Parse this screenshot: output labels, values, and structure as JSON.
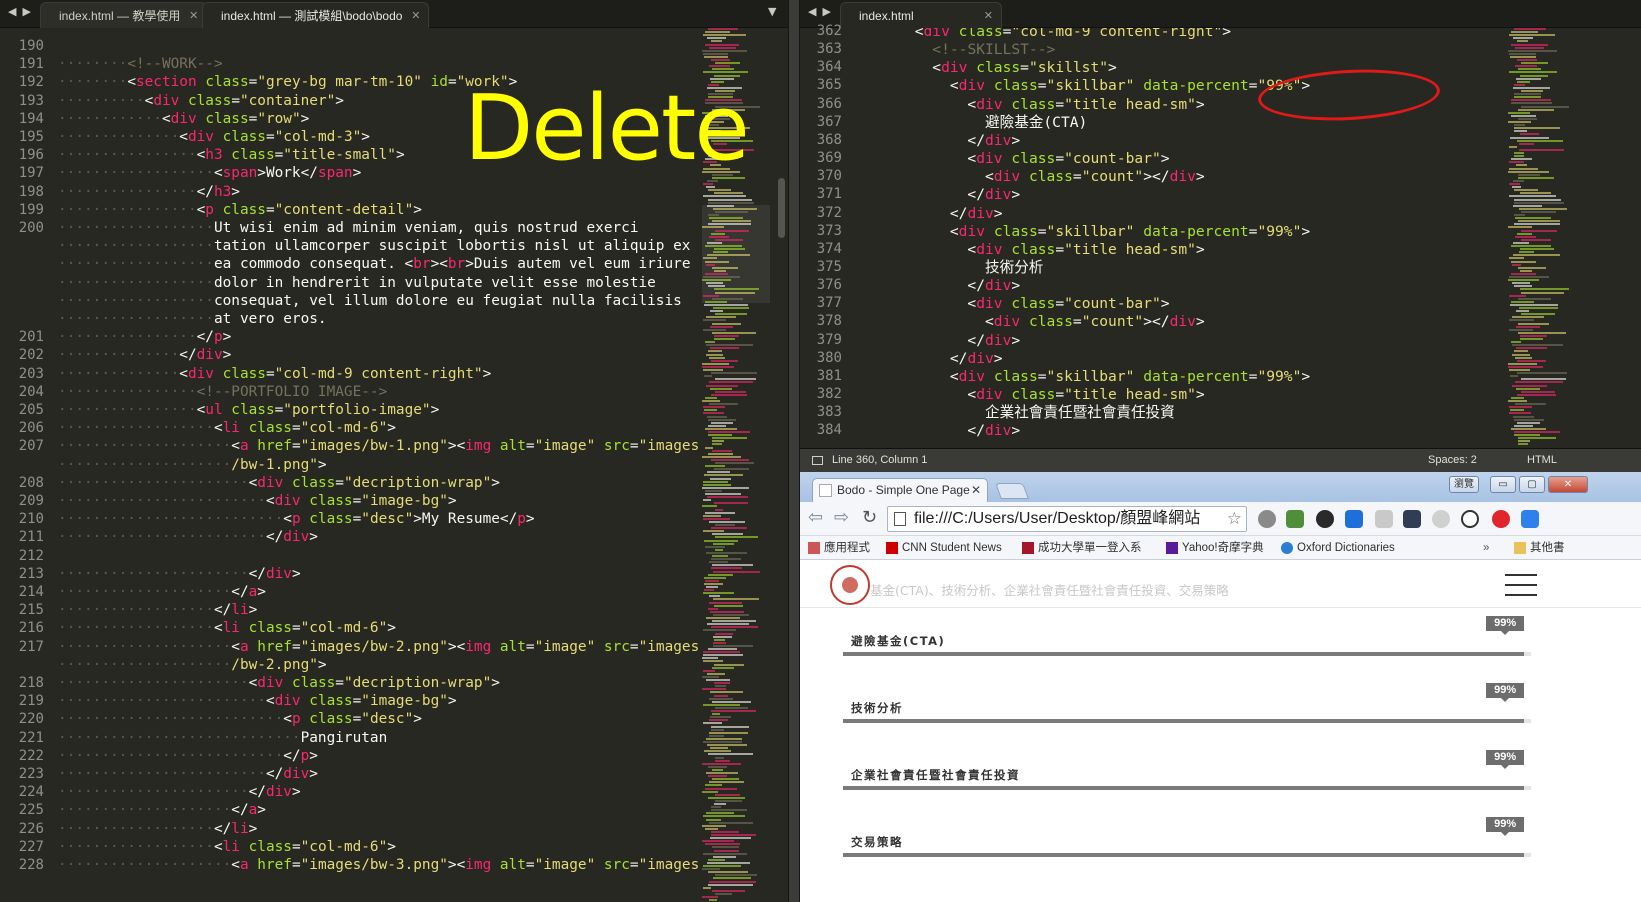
{
  "left_editor": {
    "tabs": [
      {
        "label": "index.html — 教學使用",
        "active": false
      },
      {
        "label": "index.html — 測試模組\\bodo\\bodo",
        "active": true
      }
    ],
    "annotation": "Delete",
    "lines": [
      {
        "n": "190",
        "indent": 0,
        "html": ""
      },
      {
        "n": "191",
        "indent": 4,
        "html": "<span class=\"c\">&lt;!--WORK--&gt;</span>"
      },
      {
        "n": "192",
        "indent": 4,
        "html": "&lt;<span class=\"t\">section</span> <span class=\"a\">class</span>=<span class=\"s\">\"grey-bg mar-tm-10\"</span> <span class=\"a\">id</span>=<span class=\"s\">\"work\"</span>&gt;"
      },
      {
        "n": "193",
        "indent": 5,
        "html": "&lt;<span class=\"t\">div</span> <span class=\"a\">class</span>=<span class=\"s\">\"container\"</span>&gt;"
      },
      {
        "n": "194",
        "indent": 6,
        "html": "&lt;<span class=\"t\">div</span> <span class=\"a\">class</span>=<span class=\"s\">\"row\"</span>&gt;"
      },
      {
        "n": "195",
        "indent": 7,
        "html": "&lt;<span class=\"t\">div</span> <span class=\"a\">class</span>=<span class=\"s\">\"col-md-3\"</span>&gt;"
      },
      {
        "n": "196",
        "indent": 8,
        "html": "&lt;<span class=\"t\">h3</span> <span class=\"a\">class</span>=<span class=\"s\">\"title-small\"</span>&gt;"
      },
      {
        "n": "197",
        "indent": 9,
        "html": "&lt;<span class=\"t\">span</span>&gt;Work&lt;/<span class=\"t\">span</span>&gt;"
      },
      {
        "n": "198",
        "indent": 8,
        "html": "&lt;/<span class=\"t\">h3</span>&gt;"
      },
      {
        "n": "199",
        "indent": 8,
        "html": "&lt;<span class=\"t\">p</span> <span class=\"a\">class</span>=<span class=\"s\">\"content-detail\"</span>&gt;"
      },
      {
        "n": "200",
        "indent": 9,
        "html": "Ut wisi enim ad minim veniam, quis nostrud exerci"
      },
      {
        "n": "",
        "indent": 9,
        "html": "tation ullamcorper suscipit lobortis nisl ut aliquip ex"
      },
      {
        "n": "",
        "indent": 9,
        "html": "ea commodo consequat. &lt;<span class=\"t\">br</span>&gt;&lt;<span class=\"t\">br</span>&gt;Duis autem vel eum iriure"
      },
      {
        "n": "",
        "indent": 9,
        "html": "dolor in hendrerit in vulputate velit esse molestie"
      },
      {
        "n": "",
        "indent": 9,
        "html": "consequat, vel illum dolore eu feugiat nulla facilisis"
      },
      {
        "n": "",
        "indent": 9,
        "html": "at vero eros."
      },
      {
        "n": "201",
        "indent": 8,
        "html": "&lt;/<span class=\"t\">p</span>&gt;"
      },
      {
        "n": "202",
        "indent": 7,
        "html": "&lt;/<span class=\"t\">div</span>&gt;"
      },
      {
        "n": "203",
        "indent": 7,
        "html": "&lt;<span class=\"t\">div</span> <span class=\"a\">class</span>=<span class=\"s\">\"col-md-9 content-right\"</span>&gt;"
      },
      {
        "n": "204",
        "indent": 8,
        "html": "<span class=\"c\">&lt;!--PORTFOLIO IMAGE--&gt;</span>"
      },
      {
        "n": "205",
        "indent": 8,
        "html": "&lt;<span class=\"t\">ul</span> <span class=\"a\">class</span>=<span class=\"s\">\"portfolio-image\"</span>&gt;"
      },
      {
        "n": "206",
        "indent": 9,
        "html": "&lt;<span class=\"t\">li</span> <span class=\"a\">class</span>=<span class=\"s\">\"col-md-6\"</span>&gt;"
      },
      {
        "n": "207",
        "indent": 10,
        "html": "&lt;<span class=\"t\">a</span> <span class=\"a\">href</span>=<span class=\"s\">\"images/bw-1.png\"</span>&gt;&lt;<span class=\"t\">img</span> <span class=\"a\">alt</span>=<span class=\"s\">\"image\"</span> <span class=\"a\">src</span>=<span class=\"s\">\"images</span>"
      },
      {
        "n": "",
        "indent": 10,
        "html": "<span class=\"s\">/bw-1.png\"</span>&gt;"
      },
      {
        "n": "208",
        "indent": 11,
        "html": "&lt;<span class=\"t\">div</span> <span class=\"a\">class</span>=<span class=\"s\">\"decription-wrap\"</span>&gt;"
      },
      {
        "n": "209",
        "indent": 12,
        "html": "&lt;<span class=\"t\">div</span> <span class=\"a\">class</span>=<span class=\"s\">\"image-bg\"</span>&gt;"
      },
      {
        "n": "210",
        "indent": 13,
        "html": "&lt;<span class=\"t\">p</span> <span class=\"a\">class</span>=<span class=\"s\">\"desc\"</span>&gt;My Resume&lt;/<span class=\"t\">p</span>&gt;"
      },
      {
        "n": "211",
        "indent": 12,
        "html": "&lt;/<span class=\"t\">div</span>&gt;"
      },
      {
        "n": "212",
        "indent": 0,
        "html": ""
      },
      {
        "n": "213",
        "indent": 11,
        "html": "&lt;/<span class=\"t\">div</span>&gt;"
      },
      {
        "n": "214",
        "indent": 10,
        "html": "&lt;/<span class=\"t\">a</span>&gt;"
      },
      {
        "n": "215",
        "indent": 9,
        "html": "&lt;/<span class=\"t\">li</span>&gt;"
      },
      {
        "n": "216",
        "indent": 9,
        "html": "&lt;<span class=\"t\">li</span> <span class=\"a\">class</span>=<span class=\"s\">\"col-md-6\"</span>&gt;"
      },
      {
        "n": "217",
        "indent": 10,
        "html": "&lt;<span class=\"t\">a</span> <span class=\"a\">href</span>=<span class=\"s\">\"images/bw-2.png\"</span>&gt;&lt;<span class=\"t\">img</span> <span class=\"a\">alt</span>=<span class=\"s\">\"image\"</span> <span class=\"a\">src</span>=<span class=\"s\">\"images</span>"
      },
      {
        "n": "",
        "indent": 10,
        "html": "<span class=\"s\">/bw-2.png\"</span>&gt;"
      },
      {
        "n": "218",
        "indent": 11,
        "html": "&lt;<span class=\"t\">div</span> <span class=\"a\">class</span>=<span class=\"s\">\"decription-wrap\"</span>&gt;"
      },
      {
        "n": "219",
        "indent": 12,
        "html": "&lt;<span class=\"t\">div</span> <span class=\"a\">class</span>=<span class=\"s\">\"image-bg\"</span>&gt;"
      },
      {
        "n": "220",
        "indent": 13,
        "html": "&lt;<span class=\"t\">p</span> <span class=\"a\">class</span>=<span class=\"s\">\"desc\"</span>&gt;"
      },
      {
        "n": "221",
        "indent": 14,
        "html": "Pangirutan"
      },
      {
        "n": "222",
        "indent": 13,
        "html": "&lt;/<span class=\"t\">p</span>&gt;"
      },
      {
        "n": "223",
        "indent": 12,
        "html": "&lt;/<span class=\"t\">div</span>&gt;"
      },
      {
        "n": "224",
        "indent": 11,
        "html": "&lt;/<span class=\"t\">div</span>&gt;"
      },
      {
        "n": "225",
        "indent": 10,
        "html": "&lt;/<span class=\"t\">a</span>&gt;"
      },
      {
        "n": "226",
        "indent": 9,
        "html": "&lt;/<span class=\"t\">li</span>&gt;"
      },
      {
        "n": "227",
        "indent": 9,
        "html": "&lt;<span class=\"t\">li</span> <span class=\"a\">class</span>=<span class=\"s\">\"col-md-6\"</span>&gt;"
      },
      {
        "n": "228",
        "indent": 10,
        "html": "&lt;<span class=\"t\">a</span> <span class=\"a\">href</span>=<span class=\"s\">\"images/bw-3.png\"</span>&gt;&lt;<span class=\"t\">img</span> <span class=\"a\">alt</span>=<span class=\"s\">\"image\"</span> <span class=\"a\">src</span>=<span class=\"s\">\"images</span>"
      }
    ]
  },
  "right_editor": {
    "tab": "index.html",
    "lines": [
      {
        "n": "362",
        "html": "      &lt;<span class=\"t\">div</span> <span class=\"a\">class</span>=<span class=\"s\">\"col-md-9 content-right\"</span>&gt;"
      },
      {
        "n": "363",
        "html": "        <span class=\"c\">&lt;!--SKILLST--&gt;</span>"
      },
      {
        "n": "364",
        "html": "        &lt;<span class=\"t\">div</span> <span class=\"a\">class</span>=<span class=\"s\">\"skillst\"</span>&gt;"
      },
      {
        "n": "365",
        "html": "          &lt;<span class=\"t\">div</span> <span class=\"a\">class</span>=<span class=\"s\">\"skillbar\"</span> <span class=\"a\">data-percent</span>=<span class=\"s\">\"99%\"</span>&gt;"
      },
      {
        "n": "366",
        "html": "            &lt;<span class=\"t\">div</span> <span class=\"a\">class</span>=<span class=\"s\">\"title head-sm\"</span>&gt;"
      },
      {
        "n": "367",
        "html": "              避險基金(CTA)"
      },
      {
        "n": "368",
        "html": "            &lt;/<span class=\"t\">div</span>&gt;"
      },
      {
        "n": "369",
        "html": "            &lt;<span class=\"t\">div</span> <span class=\"a\">class</span>=<span class=\"s\">\"count-bar\"</span>&gt;"
      },
      {
        "n": "370",
        "html": "              &lt;<span class=\"t\">div</span> <span class=\"a\">class</span>=<span class=\"s\">\"count\"</span>&gt;&lt;/<span class=\"t\">div</span>&gt;"
      },
      {
        "n": "371",
        "html": "            &lt;/<span class=\"t\">div</span>&gt;"
      },
      {
        "n": "372",
        "html": "          &lt;/<span class=\"t\">div</span>&gt;"
      },
      {
        "n": "373",
        "html": "          &lt;<span class=\"t\">div</span> <span class=\"a\">class</span>=<span class=\"s\">\"skillbar\"</span> <span class=\"a\">data-percent</span>=<span class=\"s\">\"99%\"</span>&gt;"
      },
      {
        "n": "374",
        "html": "            &lt;<span class=\"t\">div</span> <span class=\"a\">class</span>=<span class=\"s\">\"title head-sm\"</span>&gt;"
      },
      {
        "n": "375",
        "html": "              技術分析"
      },
      {
        "n": "376",
        "html": "            &lt;/<span class=\"t\">div</span>&gt;"
      },
      {
        "n": "377",
        "html": "            &lt;<span class=\"t\">div</span> <span class=\"a\">class</span>=<span class=\"s\">\"count-bar\"</span>&gt;"
      },
      {
        "n": "378",
        "html": "              &lt;<span class=\"t\">div</span> <span class=\"a\">class</span>=<span class=\"s\">\"count\"</span>&gt;&lt;/<span class=\"t\">div</span>&gt;"
      },
      {
        "n": "379",
        "html": "            &lt;/<span class=\"t\">div</span>&gt;"
      },
      {
        "n": "380",
        "html": "          &lt;/<span class=\"t\">div</span>&gt;"
      },
      {
        "n": "381",
        "html": "          &lt;<span class=\"t\">div</span> <span class=\"a\">class</span>=<span class=\"s\">\"skillbar\"</span> <span class=\"a\">data-percent</span>=<span class=\"s\">\"99%\"</span>&gt;"
      },
      {
        "n": "382",
        "html": "            &lt;<span class=\"t\">div</span> <span class=\"a\">class</span>=<span class=\"s\">\"title head-sm\"</span>&gt;"
      },
      {
        "n": "383",
        "html": "              企業社會責任暨社會責任投資"
      },
      {
        "n": "384",
        "html": "            &lt;/<span class=\"t\">div</span>&gt;"
      }
    ],
    "status": {
      "position": "Line 360, Column 1",
      "spaces": "Spaces: 2",
      "syntax": "HTML"
    }
  },
  "browser": {
    "window_button_label": "瀏覽",
    "tab_title": "Bodo - Simple One Page",
    "url": "file:///C:/Users/User/Desktop/顏盟峰網站",
    "bookmarks": [
      "應用程式",
      "CNN Student News",
      "成功大學單一登入系",
      "Yahoo!奇摩字典",
      "Oxford Dictionaries"
    ],
    "other_bookmarks": "其他書",
    "nav_text": "基金(CTA)、技術分析、企業社會責任暨社會責任投資、交易策略",
    "skills": [
      {
        "title": "避險基金(CTA)",
        "percent": "99%",
        "level": 0.99
      },
      {
        "title": "技術分析",
        "percent": "99%",
        "level": 0.99
      },
      {
        "title": "企業社會責任暨社會責任投資",
        "percent": "99%",
        "level": 0.99
      },
      {
        "title": "交易策略",
        "percent": "99%",
        "level": 0.99
      }
    ]
  },
  "colors": {
    "tag": "#f92672",
    "attr": "#a6e22e",
    "string": "#e6db74",
    "comment": "#75715e",
    "annotation": "#ffff00",
    "circle": "#e01a1a"
  }
}
